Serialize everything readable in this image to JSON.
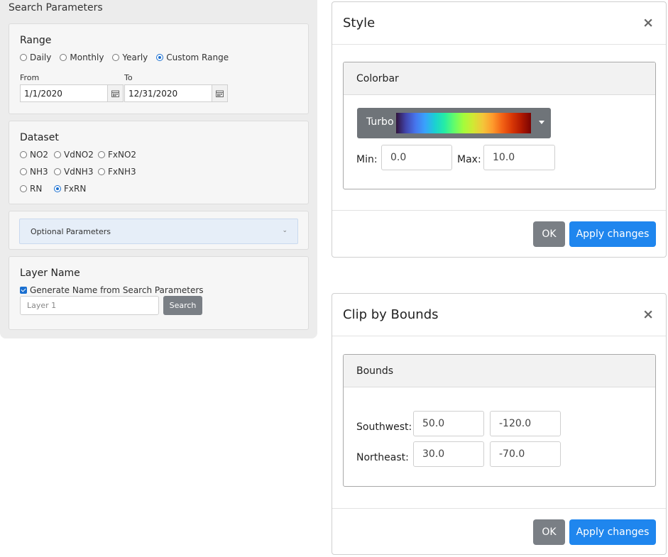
{
  "search_panel": {
    "title": "Search Parameters",
    "range": {
      "title": "Range",
      "options": [
        "Daily",
        "Monthly",
        "Yearly",
        "Custom Range"
      ],
      "selected": "Custom Range",
      "from_label": "From",
      "from_value": "1/1/2020",
      "to_label": "To",
      "to_value": "12/31/2020"
    },
    "dataset": {
      "title": "Dataset",
      "rows": [
        [
          "NO2",
          "VdNO2",
          "FxNO2"
        ],
        [
          "NH3",
          "VdNH3",
          "FxNH3"
        ],
        [
          "RN",
          "FxRN"
        ]
      ],
      "selected": "FxRN"
    },
    "optional": {
      "label": "Optional Parameters"
    },
    "layer": {
      "title": "Layer Name",
      "checkbox_label": "Generate Name from Search Parameters",
      "checked": true,
      "input_placeholder": "Layer 1",
      "search_label": "Search"
    }
  },
  "style_modal": {
    "title": "Style",
    "close": "×",
    "section_title": "Colorbar",
    "colormap_name": "Turbo",
    "min_label": "Min:",
    "min_value": "0.0",
    "max_label": "Max:",
    "max_value": "10.0",
    "ok_label": "OK",
    "apply_label": "Apply changes"
  },
  "clip_modal": {
    "title": "Clip by Bounds",
    "close": "×",
    "section_title": "Bounds",
    "southwest_label": "Southwest:",
    "southwest_values": [
      "50.0",
      "-120.0"
    ],
    "northeast_label": "Northeast:",
    "northeast_values": [
      "30.0",
      "-70.0"
    ],
    "ok_label": "OK",
    "apply_label": "Apply changes"
  },
  "colors": {
    "primary": "#1f86ee",
    "secondary": "#7a7f85",
    "radio_checked": "#1a6fd0",
    "panel_bg": "#ececec"
  }
}
